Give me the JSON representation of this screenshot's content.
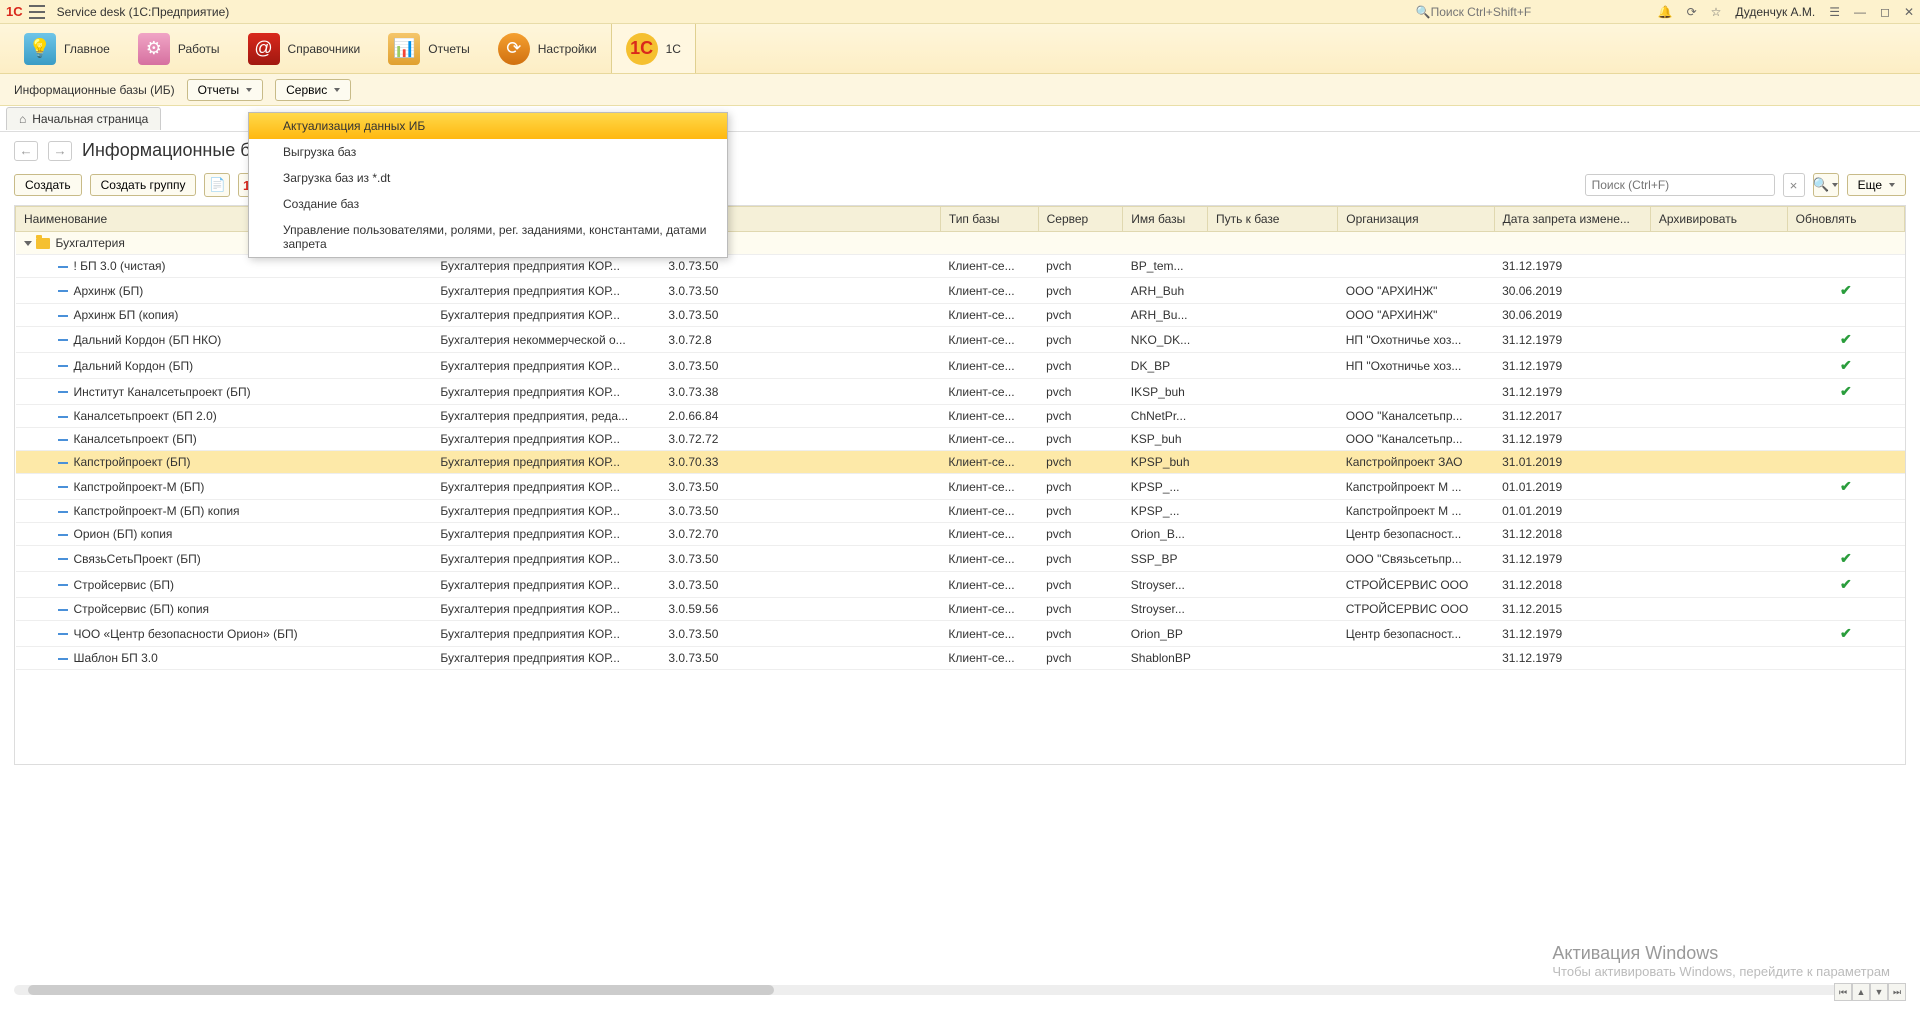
{
  "title_bar": {
    "app_title": "Service desk  (1С:Предприятие)",
    "search_placeholder": "Поиск Ctrl+Shift+F",
    "user": "Дуденчук А.М."
  },
  "main_tabs": {
    "home": "Главное",
    "work": "Работы",
    "ref": "Справочники",
    "reports": "Отчеты",
    "settings": "Настройки",
    "onec": "1C"
  },
  "sub_toolbar": {
    "label": "Информационные базы (ИБ)",
    "reports_btn": "Отчеты",
    "service_btn": "Сервис"
  },
  "tabs": {
    "home_tab": "Начальная страница"
  },
  "page": {
    "title": "Информационные базы",
    "create": "Создать",
    "create_group": "Создать группу",
    "more": "Еще",
    "search_placeholder": "Поиск (Ctrl+F)"
  },
  "dropdown": {
    "i0": "Актуализация данных ИБ",
    "i1": "Выгрузка баз",
    "i2": "Загрузка баз из *.dt",
    "i3": "Создание баз",
    "i4": "Управление пользователями, ролями, рег. заданиями, константами, датами запрета"
  },
  "columns": {
    "c0": "Наименование",
    "c1": "",
    "c2": "",
    "c3": "Тип базы",
    "c4": "Сервер",
    "c5": "Имя базы",
    "c6": "Путь к базе",
    "c7": "Организация",
    "c8": "Дата запрета измене...",
    "c9": "Архивировать",
    "c10": "Обновлять"
  },
  "group": {
    "name": "Бухгалтерия"
  },
  "rows": [
    {
      "name": "! БП 3.0 (чистая)",
      "conf": "Бухгалтерия предприятия КОР...",
      "ver": "3.0.73.50",
      "type": "Клиент-се...",
      "srv": "pvch",
      "db": "BP_tem...",
      "org": "",
      "date": "31.12.1979",
      "arch": "",
      "upd": ""
    },
    {
      "name": "Архинж (БП)",
      "conf": "Бухгалтерия предприятия КОР...",
      "ver": "3.0.73.50",
      "type": "Клиент-се...",
      "srv": "pvch",
      "db": "ARH_Buh",
      "org": "ООО \"АРХИНЖ\"",
      "date": "30.06.2019",
      "arch": "",
      "upd": "✓"
    },
    {
      "name": "Архинж БП (копия)",
      "conf": "Бухгалтерия предприятия КОР...",
      "ver": "3.0.73.50",
      "type": "Клиент-се...",
      "srv": "pvch",
      "db": "ARH_Bu...",
      "org": "ООО \"АРХИНЖ\"",
      "date": "30.06.2019",
      "arch": "",
      "upd": ""
    },
    {
      "name": "Дальний Кордон (БП НКО)",
      "conf": "Бухгалтерия некоммерческой о...",
      "ver": "3.0.72.8",
      "type": "Клиент-се...",
      "srv": "pvch",
      "db": "NKO_DK...",
      "org": "НП \"Охотничье хоз...",
      "date": "31.12.1979",
      "arch": "",
      "upd": "✓"
    },
    {
      "name": "Дальний Кордон (БП)",
      "conf": "Бухгалтерия предприятия КОР...",
      "ver": "3.0.73.50",
      "type": "Клиент-се...",
      "srv": "pvch",
      "db": "DK_BP",
      "org": "НП \"Охотничье хоз...",
      "date": "31.12.1979",
      "arch": "",
      "upd": "✓"
    },
    {
      "name": "Институт Каналсетьпроект (БП)",
      "conf": "Бухгалтерия предприятия КОР...",
      "ver": "3.0.73.38",
      "type": "Клиент-се...",
      "srv": "pvch",
      "db": "IKSP_buh",
      "org": "",
      "date": "31.12.1979",
      "arch": "",
      "upd": "✓"
    },
    {
      "name": "Каналсетьпроект (БП 2.0)",
      "conf": "Бухгалтерия предприятия, реда...",
      "ver": "2.0.66.84",
      "type": "Клиент-се...",
      "srv": "pvch",
      "db": "ChNetPr...",
      "org": "ООО \"Каналсетьпр...",
      "date": "31.12.2017",
      "arch": "",
      "upd": ""
    },
    {
      "name": "Каналсетьпроект (БП)",
      "conf": "Бухгалтерия предприятия КОР...",
      "ver": "3.0.72.72",
      "type": "Клиент-се...",
      "srv": "pvch",
      "db": "KSP_buh",
      "org": "ООО \"Каналсетьпр...",
      "date": "31.12.1979",
      "arch": "",
      "upd": ""
    },
    {
      "name": "Капстройпроект (БП)",
      "conf": "Бухгалтерия предприятия КОР...",
      "ver": "3.0.70.33",
      "type": "Клиент-се...",
      "srv": "pvch",
      "db": "KPSP_buh",
      "org": "Капстройпроект ЗАО",
      "date": "31.01.2019",
      "arch": "",
      "upd": ""
    },
    {
      "name": "Капстройпроект-М (БП)",
      "conf": "Бухгалтерия предприятия КОР...",
      "ver": "3.0.73.50",
      "type": "Клиент-се...",
      "srv": "pvch",
      "db": "KPSP_...",
      "org": "Капстройпроект М ...",
      "date": "01.01.2019",
      "arch": "",
      "upd": "✓"
    },
    {
      "name": "Капстройпроект-М (БП) копия",
      "conf": "Бухгалтерия предприятия КОР...",
      "ver": "3.0.73.50",
      "type": "Клиент-се...",
      "srv": "pvch",
      "db": "KPSP_...",
      "org": "Капстройпроект М ...",
      "date": "01.01.2019",
      "arch": "",
      "upd": ""
    },
    {
      "name": "Орион (БП) копия",
      "conf": "Бухгалтерия предприятия КОР...",
      "ver": "3.0.72.70",
      "type": "Клиент-се...",
      "srv": "pvch",
      "db": "Orion_B...",
      "org": "Центр безопасност...",
      "date": "31.12.2018",
      "arch": "",
      "upd": ""
    },
    {
      "name": "СвязьСетьПроект (БП)",
      "conf": "Бухгалтерия предприятия КОР...",
      "ver": "3.0.73.50",
      "type": "Клиент-се...",
      "srv": "pvch",
      "db": "SSP_BP",
      "org": "ООО \"Связьсетьпр...",
      "date": "31.12.1979",
      "arch": "",
      "upd": "✓"
    },
    {
      "name": "Стройсервис (БП)",
      "conf": "Бухгалтерия предприятия КОР...",
      "ver": "3.0.73.50",
      "type": "Клиент-се...",
      "srv": "pvch",
      "db": "Stroyser...",
      "org": "СТРОЙСЕРВИС ООО",
      "date": "31.12.2018",
      "arch": "",
      "upd": "✓"
    },
    {
      "name": "Стройсервис (БП) копия",
      "conf": "Бухгалтерия предприятия КОР...",
      "ver": "3.0.59.56",
      "type": "Клиент-се...",
      "srv": "pvch",
      "db": "Stroyser...",
      "org": "СТРОЙСЕРВИС ООО",
      "date": "31.12.2015",
      "arch": "",
      "upd": ""
    },
    {
      "name": "ЧОО «Центр безопасности Орион» (БП)",
      "conf": "Бухгалтерия предприятия КОР...",
      "ver": "3.0.73.50",
      "type": "Клиент-се...",
      "srv": "pvch",
      "db": "Orion_BP",
      "org": "Центр безопасност...",
      "date": "31.12.1979",
      "arch": "",
      "upd": "✓"
    },
    {
      "name": "Шаблон БП 3.0",
      "conf": "Бухгалтерия предприятия КОР...",
      "ver": "3.0.73.50",
      "type": "Клиент-се...",
      "srv": "pvch",
      "db": "ShablonBP",
      "org": "",
      "date": "31.12.1979",
      "arch": "",
      "upd": ""
    }
  ],
  "watermark": {
    "title": "Активация Windows",
    "text": "Чтобы активировать Windows, перейдите к параметрам"
  }
}
